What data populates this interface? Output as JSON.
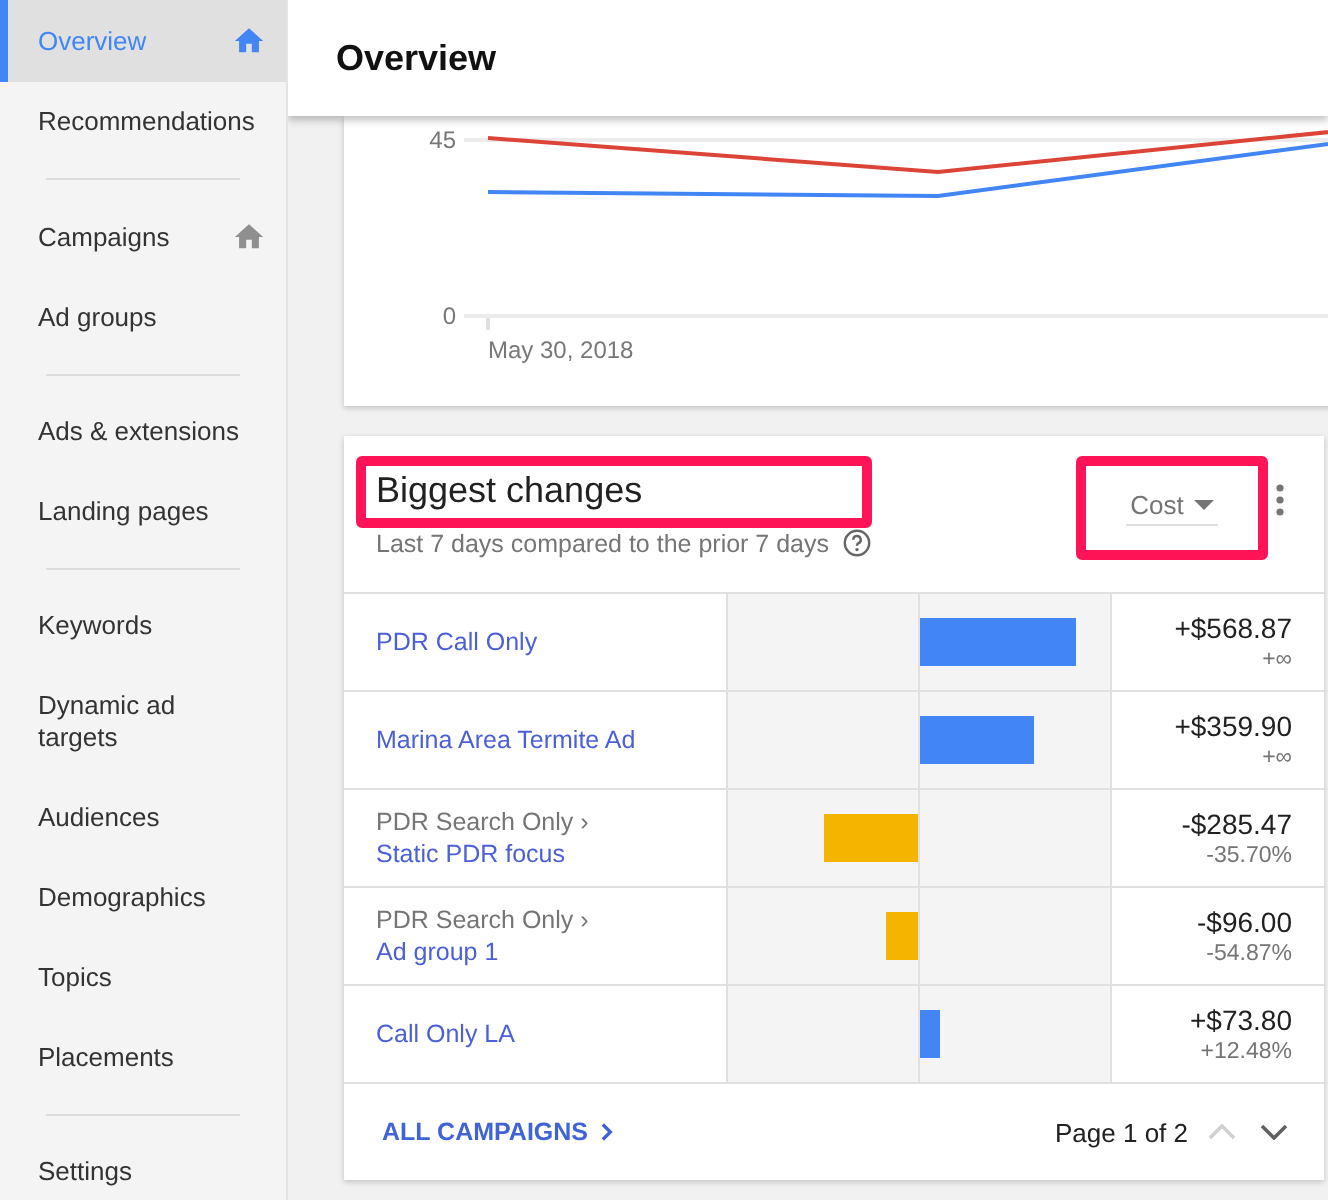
{
  "sidebar": {
    "groups": [
      [
        {
          "label": "Overview",
          "selected": true,
          "pinned": true
        },
        {
          "label": "Recommendations",
          "selected": false,
          "pinned": false
        }
      ],
      [
        {
          "label": "Campaigns",
          "selected": false,
          "pinned": true
        },
        {
          "label": "Ad groups",
          "selected": false,
          "pinned": false
        }
      ],
      [
        {
          "label": "Ads & extensions",
          "selected": false,
          "pinned": false
        },
        {
          "label": "Landing pages",
          "selected": false,
          "pinned": false
        }
      ],
      [
        {
          "label": "Keywords",
          "selected": false,
          "pinned": false
        },
        {
          "label": "Dynamic ad targets",
          "selected": false,
          "pinned": false
        },
        {
          "label": "Audiences",
          "selected": false,
          "pinned": false
        },
        {
          "label": "Demographics",
          "selected": false,
          "pinned": false
        },
        {
          "label": "Topics",
          "selected": false,
          "pinned": false
        },
        {
          "label": "Placements",
          "selected": false,
          "pinned": false
        }
      ],
      [
        {
          "label": "Settings",
          "selected": false,
          "pinned": false
        }
      ]
    ]
  },
  "header": {
    "title": "Overview"
  },
  "overview_chart": {
    "y_labels": [
      "45",
      "0"
    ],
    "date_label": "May 30, 2018"
  },
  "biggest_changes": {
    "title": "Biggest changes",
    "title_highlighted": true,
    "subtitle": "Last 7 days compared to the prior 7 days",
    "metric": "Cost",
    "metric_highlighted": true,
    "rows": [
      {
        "kind": "increase",
        "name": "PDR Call Only",
        "level": 0.82,
        "change": "+$568.87",
        "percent": "+∞"
      },
      {
        "kind": "increase",
        "name": "Marina Area Termite Ad",
        "level": 0.6,
        "change": "+$359.90",
        "percent": "+∞"
      },
      {
        "kind": "decrease",
        "parent": "PDR Search Only ›",
        "name": "Static PDR focus",
        "level": 0.49,
        "change": "-$285.47",
        "percent": "-35.70%"
      },
      {
        "kind": "decrease",
        "parent": "PDR Search Only ›",
        "name": "Ad group 1",
        "level": 0.17,
        "change": "-$96.00",
        "percent": "-54.87%"
      },
      {
        "kind": "increase",
        "name": "Call Only LA",
        "level": 0.11,
        "change": "+$73.80",
        "percent": "+12.48%"
      }
    ],
    "footer_link": "ALL CAMPAIGNS",
    "page": "Page 1 of 2",
    "prev_disabled": true,
    "next_disabled": false
  }
}
